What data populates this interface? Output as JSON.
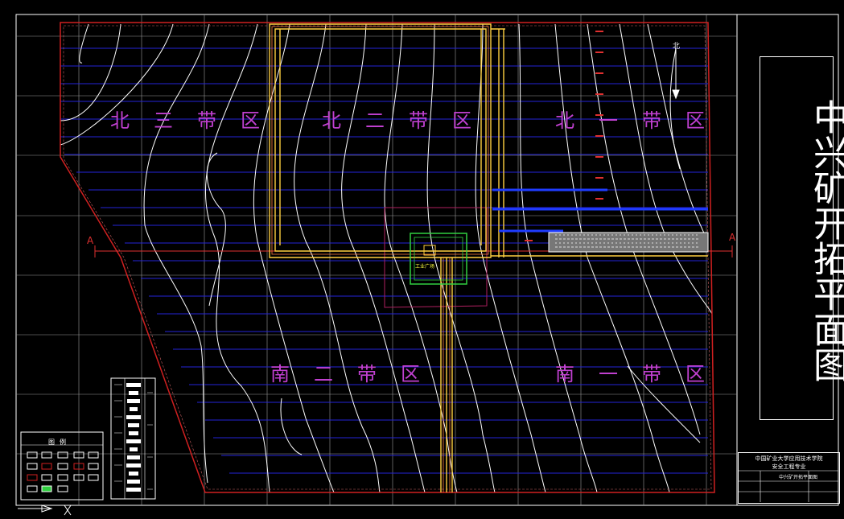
{
  "title": "中兴矿开拓平面图",
  "zones": [
    {
      "id": "bei-san",
      "label": "北三带区"
    },
    {
      "id": "bei-er",
      "label": "北二带区"
    },
    {
      "id": "bei-yi",
      "label": "北一带区"
    },
    {
      "id": "nan-er",
      "label": "南二带区"
    },
    {
      "id": "nan-yi",
      "label": "南一带区"
    }
  ],
  "section_line": {
    "left": "A",
    "right": "A"
  },
  "mine_label": "工业广场",
  "north_arrow": "北",
  "legend": {
    "title": "图例"
  },
  "title_block": {
    "school_line1": "中国矿业大学应用技术学院",
    "school_line2": "安全工程专业",
    "drawing_name": "中兴矿开拓平面图"
  },
  "colors": {
    "background": "#000000",
    "grid": "#2020d0",
    "contours": "#ffffff",
    "boundary": "#d02020",
    "shafts": "#ffd040",
    "zone_text": "#c040d0",
    "roadway": "#1f3cff",
    "plant": "#30d040"
  }
}
